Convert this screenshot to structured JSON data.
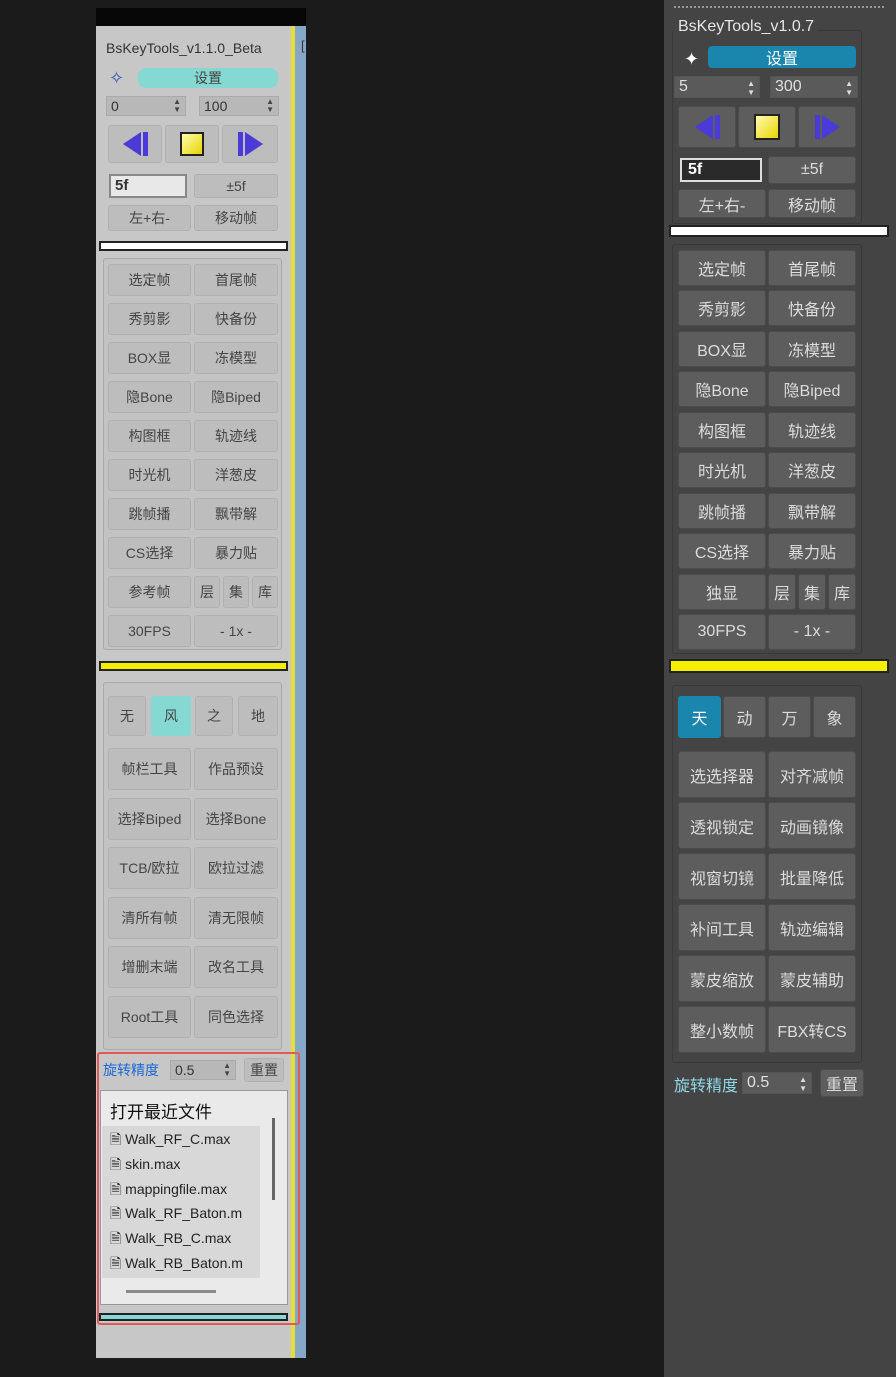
{
  "left_panel": {
    "title": "BsKeyTools_v1.1.0_Beta",
    "settings_label": "设置",
    "spinners": [
      "0",
      "100"
    ],
    "frame_value": "5f",
    "offset_label": "±5f",
    "lr_label": "左+右-",
    "move_label": "移动帧",
    "grid": [
      "选定帧",
      "首尾帧",
      "秀剪影",
      "快备份",
      "BOX显",
      "冻模型",
      "隐Bone",
      "隐Biped",
      "构图框",
      "轨迹线",
      "时光机",
      "洋葱皮",
      "跳帧播",
      "飘带解",
      "CS选择",
      "暴力贴"
    ],
    "ref_label": "参考帧",
    "small_btns": [
      "层",
      "集",
      "库"
    ],
    "fps_label": "30FPS",
    "speed_label": "- 1x -",
    "tabs": [
      "无",
      "风",
      "之",
      "地"
    ],
    "tool_grid": [
      "帧栏工具",
      "作品预设",
      "选择Biped",
      "选择Bone",
      "TCB/欧拉",
      "欧拉过滤",
      "清所有帧",
      "清无限帧",
      "增删末端",
      "改名工具",
      "Root工具",
      "同色选择"
    ],
    "rot_label": "旋转精度",
    "rot_value": "0.5",
    "reset_label": "重置",
    "recent_title": "打开最近文件",
    "recent_files": [
      "Walk_RF_C.max",
      "skin.max",
      "mappingfile.max",
      "Walk_RF_Baton.m",
      "Walk_RB_C.max",
      "Walk_RB_Baton.m"
    ]
  },
  "right_panel": {
    "title": "BsKeyTools_v1.0.7",
    "settings_label": "设置",
    "spinners": [
      "5",
      "300"
    ],
    "frame_value": "5f",
    "offset_label": "±5f",
    "lr_label": "左+右-",
    "move_label": "移动帧",
    "grid": [
      "选定帧",
      "首尾帧",
      "秀剪影",
      "快备份",
      "BOX显",
      "冻模型",
      "隐Bone",
      "隐Biped",
      "构图框",
      "轨迹线",
      "时光机",
      "洋葱皮",
      "跳帧播",
      "飘带解",
      "CS选择",
      "暴力贴"
    ],
    "solo_label": "独显",
    "small_btns": [
      "层",
      "集",
      "库"
    ],
    "fps_label": "30FPS",
    "speed_label": "- 1x -",
    "tabs": [
      "天",
      "动",
      "万",
      "象"
    ],
    "tool_grid": [
      "选选择器",
      "对齐减帧",
      "透视锁定",
      "动画镜像",
      "视窗切镜",
      "批量降低",
      "补间工具",
      "轨迹编辑",
      "蒙皮缩放",
      "蒙皮辅助",
      "整小数帧",
      "FBX转CS"
    ],
    "rot_label": "旋转精度",
    "rot_value": "0.5",
    "reset_label": "重置"
  },
  "colors": {
    "highlight_teal": "#86d8d2",
    "accent_blue": "#1a85ad",
    "selection_red": "#e05a5a",
    "divider_yellow": "#f4ef00",
    "play_blue": "#4a3ad8"
  },
  "icons": [
    "pin-icon",
    "prev-frame-icon",
    "stop-icon",
    "next-frame-icon",
    "file-icon"
  ]
}
